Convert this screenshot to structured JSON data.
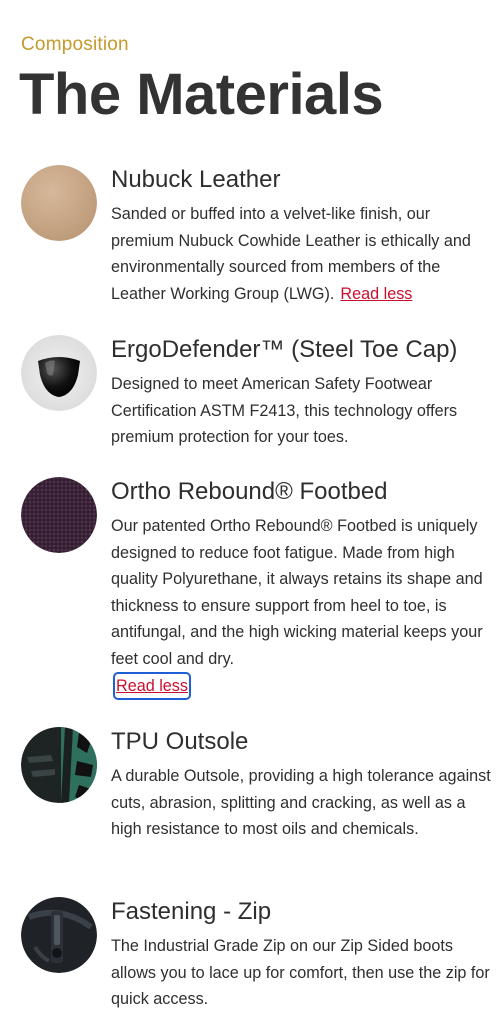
{
  "header": {
    "eyebrow": "Composition",
    "title": "The Materials"
  },
  "read_less_label": "Read less",
  "materials": [
    {
      "title": "Nubuck Leather",
      "body": "Sanded or buffed into a velvet-like finish, our premium Nubuck Cowhide Leather is ethically and environmentally sourced from members of the Leather Working Group (LWG).",
      "icon": "nubuck-leather-swatch-icon"
    },
    {
      "title": "ErgoDefender™ (Steel Toe Cap)",
      "body": "Designed to meet American Safety Footwear Certification ASTM F2413, this technology offers premium protection for your toes.",
      "icon": "steel-toe-cap-icon"
    },
    {
      "title": "Ortho Rebound® Footbed",
      "body": "Our patented Ortho Rebound® Footbed is uniquely designed to reduce foot fatigue. Made from high quality Polyurethane, it always retains its shape and thickness to ensure support from heel to toe, is antifungal, and the high wicking material keeps your feet cool and dry.",
      "icon": "footbed-fabric-swatch-icon"
    },
    {
      "title": "TPU Outsole",
      "body": "A durable Outsole, providing a high tolerance against cuts, abrasion, splitting and cracking, as well as a high resistance to most oils and chemicals.",
      "icon": "tpu-outsole-icon"
    },
    {
      "title": "Fastening - Zip",
      "body": "The Industrial Grade Zip on our Zip Sided boots allows you to lace up for comfort, then use the zip for quick access.",
      "icon": "zip-fastening-icon"
    }
  ],
  "colors": {
    "accent_gold": "#c49a2c",
    "link_red": "#c8102e",
    "focus_blue": "#1f5fd6"
  }
}
